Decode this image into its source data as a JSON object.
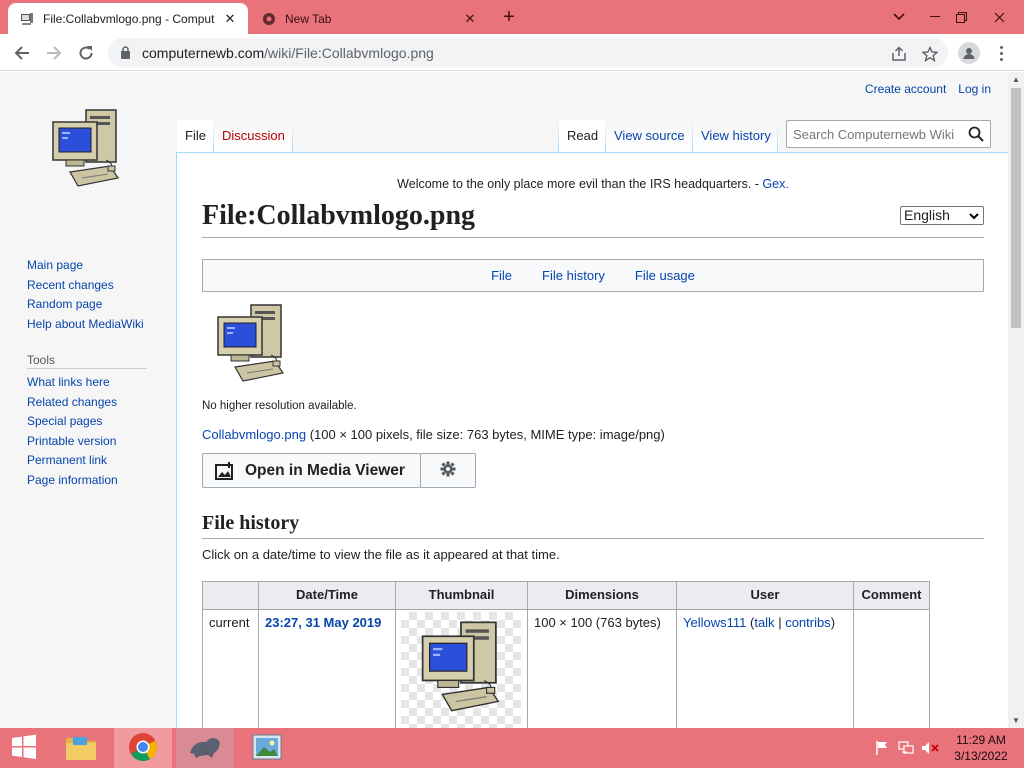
{
  "browser": {
    "tabs": [
      {
        "title": "File:Collabvmlogo.png - Comput",
        "close": "✕"
      },
      {
        "title": "New Tab",
        "close": "✕"
      }
    ],
    "new_tab": "+",
    "window_controls": {
      "dropdown": "⌄",
      "minimize": "─",
      "restore": "❐",
      "close": "✕"
    },
    "url_host": "computernewb.com",
    "url_path": "/wiki/File:Collabvmlogo.png"
  },
  "wiki": {
    "personal": {
      "create_account": "Create account",
      "log_in": "Log in"
    },
    "sidebar": {
      "nav": [
        "Main page",
        "Recent changes",
        "Random page",
        "Help about MediaWiki"
      ],
      "tools_heading": "Tools",
      "tools": [
        "What links here",
        "Related changes",
        "Special pages",
        "Printable version",
        "Permanent link",
        "Page information"
      ]
    },
    "tabs": {
      "file": "File",
      "discussion": "Discussion",
      "read": "Read",
      "view_source": "View source",
      "view_history": "View history"
    },
    "search_placeholder": "Search Computernewb Wiki",
    "sitenotice": {
      "text": "Welcome to the only place more evil than the IRS headquarters. - ",
      "author": "Gex."
    },
    "language": "English",
    "title": "File:Collabvmlogo.png",
    "filetoc": [
      "File",
      "File history",
      "File usage"
    ],
    "no_higher": "No higher resolution available.",
    "fileinfo": {
      "link": "Collabvmlogo.png",
      "details": " (100 × 100 pixels, file size: 763 bytes, MIME type: image/png)"
    },
    "media_viewer": "Open in Media Viewer",
    "history_heading": "File history",
    "history_intro": "Click on a date/time to view the file as it appeared at that time.",
    "history_table": {
      "headers": [
        "",
        "Date/Time",
        "Thumbnail",
        "Dimensions",
        "User",
        "Comment"
      ],
      "rows": [
        {
          "status": "current",
          "datetime": "23:27, 31 May 2019",
          "dimensions": "100 × 100 (763 bytes)",
          "user": "Yellows111",
          "talk": "talk",
          "sep": "|",
          "contribs": "contribs",
          "open": " (",
          "close": ")",
          "comment": ""
        }
      ]
    }
  },
  "taskbar": {
    "clock_time": "11:29 AM",
    "clock_date": "3/13/2022"
  },
  "colors": {
    "accent": "#e9737b",
    "link": "#0645ad",
    "redlink": "#ba0000"
  }
}
